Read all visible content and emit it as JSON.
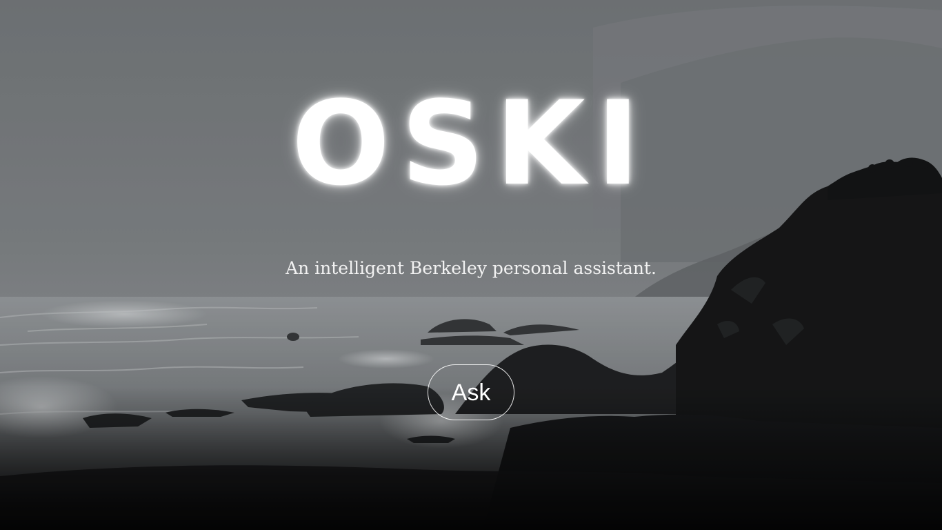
{
  "hero": {
    "title": "OSKI",
    "subtitle": "An intelligent Berkeley personal assistant.",
    "ask_label": "Ask"
  },
  "colors": {
    "text": "#ffffff",
    "sky": "#7c8083",
    "sea": "#9a9ea1",
    "rock": "#151617"
  },
  "background": {
    "image": "foggy-coastline-photo"
  }
}
